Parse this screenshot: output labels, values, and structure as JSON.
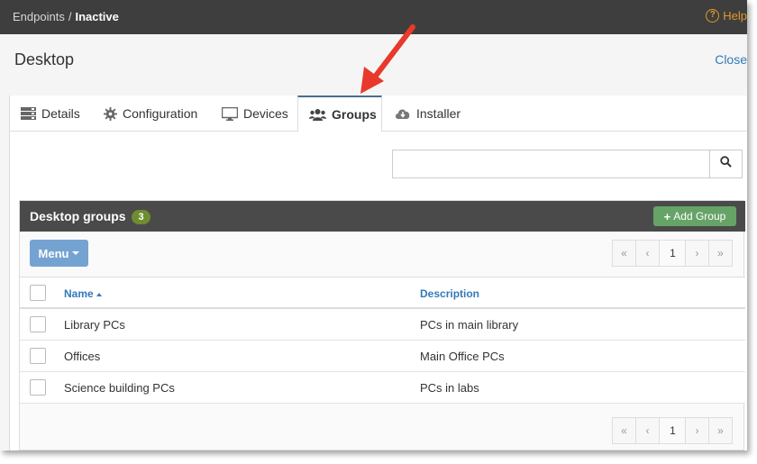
{
  "breadcrumb": {
    "parent": "Endpoints",
    "separator": "/",
    "current": "Inactive"
  },
  "help": {
    "label": "Help",
    "icon": "question-circle-icon"
  },
  "panel": {
    "title": "Desktop",
    "close_label": "Close"
  },
  "tabs": [
    {
      "label": "Details",
      "icon": "server-icon",
      "active": false
    },
    {
      "label": "Configuration",
      "icon": "gear-icon",
      "active": false
    },
    {
      "label": "Devices",
      "icon": "monitor-icon",
      "active": false
    },
    {
      "label": "Groups",
      "icon": "users-icon",
      "active": true
    },
    {
      "label": "Installer",
      "icon": "cloud-download-icon",
      "active": false
    }
  ],
  "search": {
    "value": "",
    "placeholder": ""
  },
  "groups": {
    "title": "Desktop groups",
    "count": "3",
    "add_label": "Add Group",
    "menu_label": "Menu",
    "columns": {
      "name": "Name",
      "description": "Description"
    },
    "rows": [
      {
        "name": "Library PCs",
        "description": "PCs in main library"
      },
      {
        "name": "Offices",
        "description": "Main Office PCs"
      },
      {
        "name": "Science building PCs",
        "description": "PCs in labs"
      }
    ],
    "pagination": {
      "first": "«",
      "prev": "‹",
      "page": "1",
      "next": "›",
      "last": "»"
    }
  },
  "colors": {
    "topbar": "#3e3e3e",
    "help": "#e09a2c",
    "link": "#337ab7",
    "badge": "#6f8c2f",
    "add_button": "#66a366",
    "menu_button": "#74a3d1",
    "annotation_arrow": "#e8392b"
  }
}
